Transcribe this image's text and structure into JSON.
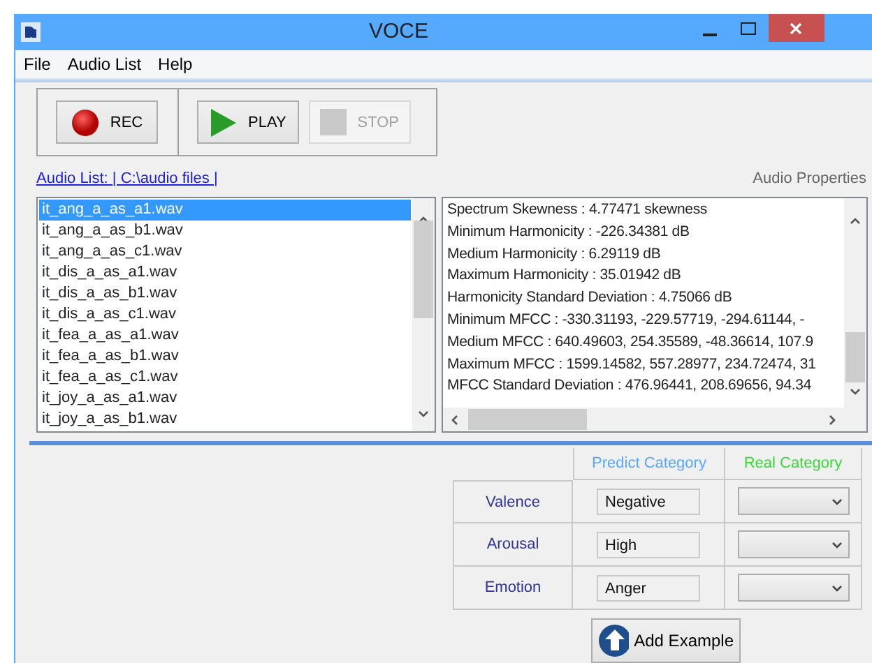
{
  "window": {
    "title": "VOCE"
  },
  "menu": [
    "File",
    "Audio List",
    "Help"
  ],
  "toolbar": [
    {
      "kind": "rec",
      "label": "REC",
      "disabled": false
    },
    {
      "kind": "play",
      "label": "PLAY",
      "disabled": false
    },
    {
      "kind": "stop",
      "label": "STOP",
      "disabled": true
    }
  ],
  "audio_list": {
    "heading": "Audio List: | C:\\audio files |",
    "items": [
      {
        "label": "it_ang_a_as_a1.wav",
        "selected": true
      },
      {
        "label": "it_ang_a_as_b1.wav",
        "selected": false
      },
      {
        "label": "it_ang_a_as_c1.wav",
        "selected": false
      },
      {
        "label": "it_dis_a_as_a1.wav",
        "selected": false
      },
      {
        "label": "it_dis_a_as_b1.wav",
        "selected": false
      },
      {
        "label": "it_dis_a_as_c1.wav",
        "selected": false
      },
      {
        "label": "it_fea_a_as_a1.wav",
        "selected": false
      },
      {
        "label": "it_fea_a_as_b1.wav",
        "selected": false
      },
      {
        "label": "it_fea_a_as_c1.wav",
        "selected": false
      },
      {
        "label": "it_joy_a_as_a1.wav",
        "selected": false
      },
      {
        "label": "it_joy_a_as_b1.wav",
        "selected": false
      }
    ]
  },
  "audio_properties": {
    "heading": "Audio Properties",
    "lines": [
      "Spectrum Skewness : 4.77471 skewness",
      "Minimum Harmonicity : -226.34381 dB",
      "Medium Harmonicity : 6.29119 dB",
      "Maximum Harmonicity : 35.01942 dB",
      "Harmonicity Standard Deviation : 4.75066 dB",
      "Minimum MFCC : -330.31193, -229.57719, -294.61144, -",
      "Medium MFCC : 640.49603, 254.35589, -48.36614, 107.9",
      "Maximum MFCC : 1599.14582, 557.28977, 234.72474, 31",
      "MFCC Standard Deviation : 476.96441, 208.69656, 94.34"
    ]
  },
  "categories": {
    "columns": [
      "Predict Category",
      "Real Category"
    ],
    "rows": [
      {
        "label": "Valence",
        "predicted": "Negative"
      },
      {
        "label": "Arousal",
        "predicted": "High"
      },
      {
        "label": "Emotion",
        "predicted": "Anger"
      }
    ]
  },
  "add_button": "Add Example"
}
